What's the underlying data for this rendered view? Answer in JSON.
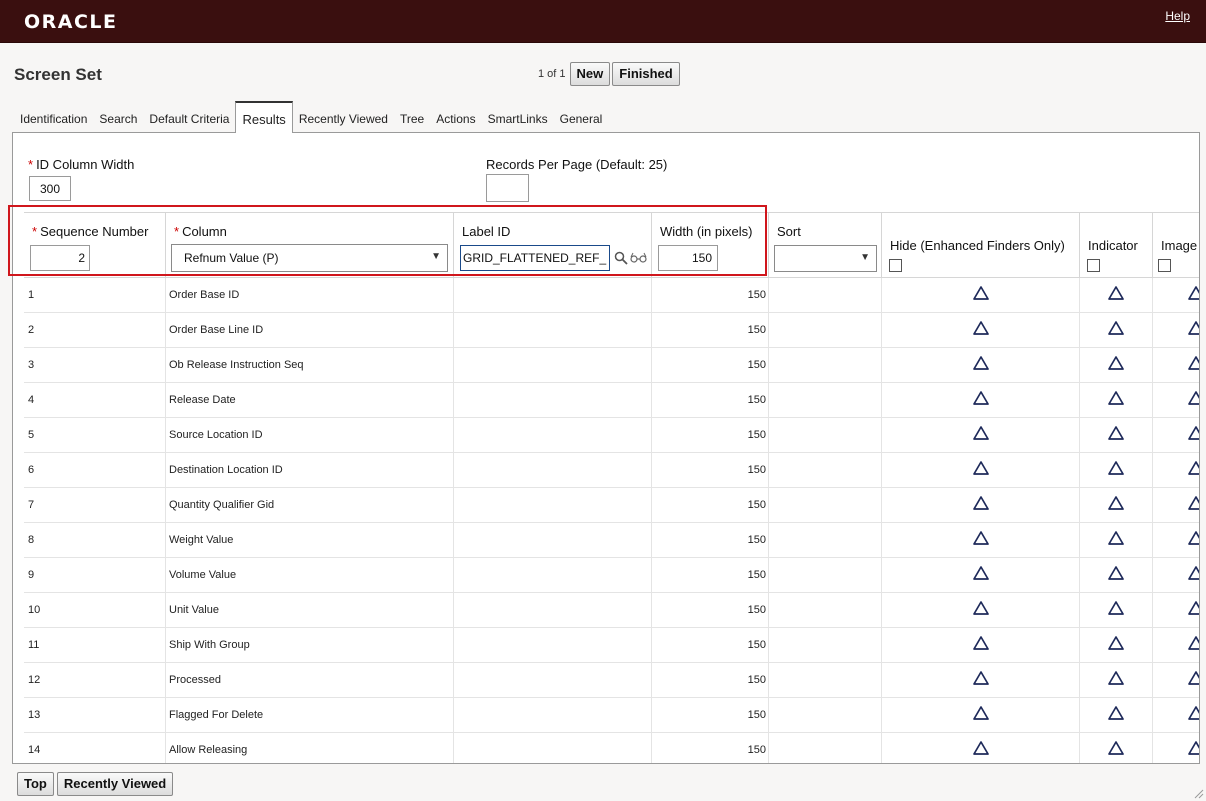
{
  "brand": "ORACLE",
  "help": "Help",
  "page_title": "Screen Set",
  "pager": {
    "text": "1 of 1",
    "new": "New",
    "finished": "Finished"
  },
  "tabs": [
    "Identification",
    "Search",
    "Default Criteria",
    "Results",
    "Recently Viewed",
    "Tree",
    "Actions",
    "SmartLinks",
    "General"
  ],
  "active_tab": "Results",
  "fields": {
    "id_width_label": "ID Column Width",
    "id_width_value": "300",
    "records_label": "Records Per Page (Default: 25)",
    "records_value": ""
  },
  "grid": {
    "headers": {
      "seq": "Sequence Number",
      "column": "Column",
      "label": "Label ID",
      "width": "Width (in pixels)",
      "sort": "Sort",
      "hide": "Hide (Enhanced Finders Only)",
      "indicator": "Indicator",
      "image": "Image"
    },
    "edit_row": {
      "seq": "2",
      "column": "Refnum Value (P)",
      "label": "GRID_FLATTENED_REF_N",
      "width": "150",
      "sort": ""
    },
    "rows": [
      {
        "seq": "1",
        "column": "Order Base ID",
        "width": "150"
      },
      {
        "seq": "2",
        "column": "Order Base Line ID",
        "width": "150"
      },
      {
        "seq": "3",
        "column": "Ob Release Instruction Seq",
        "width": "150"
      },
      {
        "seq": "4",
        "column": "Release Date",
        "width": "150"
      },
      {
        "seq": "5",
        "column": "Source Location ID",
        "width": "150"
      },
      {
        "seq": "6",
        "column": "Destination Location ID",
        "width": "150"
      },
      {
        "seq": "7",
        "column": "Quantity Qualifier Gid",
        "width": "150"
      },
      {
        "seq": "8",
        "column": "Weight Value",
        "width": "150"
      },
      {
        "seq": "9",
        "column": "Volume Value",
        "width": "150"
      },
      {
        "seq": "10",
        "column": "Unit Value",
        "width": "150"
      },
      {
        "seq": "11",
        "column": "Ship With Group",
        "width": "150"
      },
      {
        "seq": "12",
        "column": "Processed",
        "width": "150"
      },
      {
        "seq": "13",
        "column": "Flagged For Delete",
        "width": "150"
      },
      {
        "seq": "14",
        "column": "Allow Releasing",
        "width": "150"
      }
    ]
  },
  "bottom_buttons": {
    "top": "Top",
    "recently_viewed": "Recently Viewed"
  },
  "colors": {
    "header_bg": "#3a0f0f",
    "highlight": "#d0161c",
    "triangle": "#1e2a5a"
  }
}
